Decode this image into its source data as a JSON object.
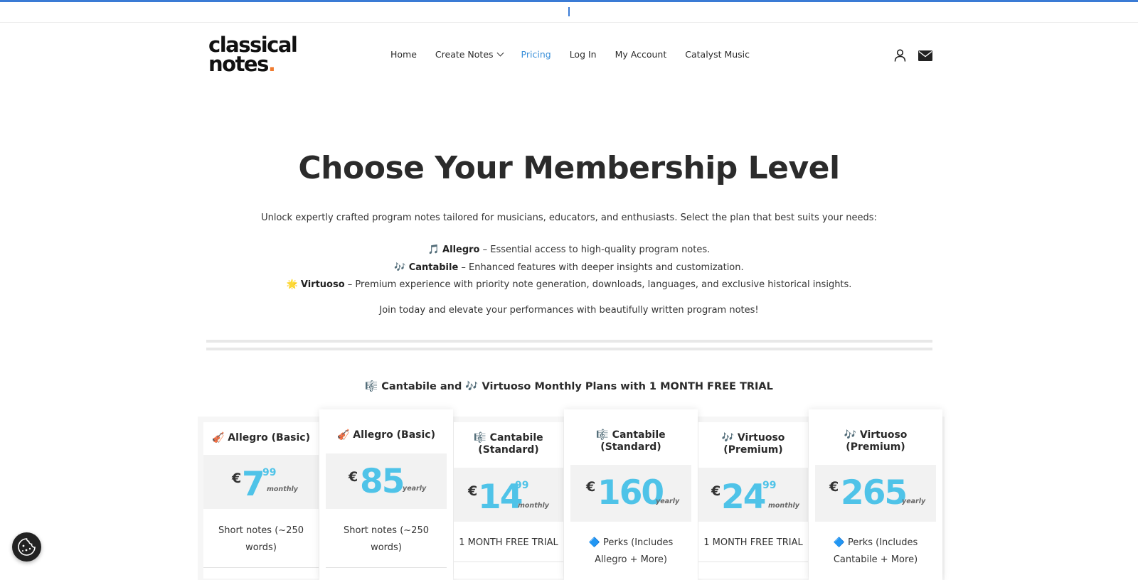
{
  "brand": {
    "logo_line1": "classical",
    "logo_line2": "notes",
    "logo_dot": ".",
    "accent": "#f07b2f"
  },
  "nav": {
    "items": [
      {
        "label": "Home"
      },
      {
        "label": "Create Notes"
      },
      {
        "label": "Pricing"
      },
      {
        "label": "Log In"
      },
      {
        "label": "My Account"
      },
      {
        "label": "Catalyst Music"
      }
    ],
    "active": "Pricing",
    "active_color": "#3a8fd9"
  },
  "header_icons": [
    "user-icon",
    "mail-icon"
  ],
  "hero": {
    "title": "Choose Your Membership Level",
    "intro": "Unlock expertly crafted program notes tailored for musicians, educators, and enthusiasts. Select the plan that best suits your needs:",
    "tiers": [
      {
        "emoji": "🎵",
        "name": "Allegro",
        "desc": " – Essential access to high-quality program notes."
      },
      {
        "emoji": "🎶",
        "name": "Cantabile",
        "desc": " – Enhanced features with deeper insights and customization."
      },
      {
        "emoji": "🌟",
        "name": "Virtuoso",
        "desc": " – Premium experience with priority note generation, downloads, languages, and exclusive historical insights."
      }
    ],
    "join": "Join today and elevate your performances with beautifully written program notes!"
  },
  "plans": {
    "heading": "🎼 Cantabile and 🎶 Virtuoso Monthly Plans with 1 MONTH FREE TRIAL",
    "cards": [
      {
        "title_lines": [
          "🎻 Allegro (Basic)"
        ],
        "currency": "€",
        "amount": "7",
        "cents": "99",
        "period": "monthly",
        "features": [
          "Short notes (~250",
          "words)"
        ]
      },
      {
        "title_lines": [
          "🎻 Allegro (Basic)"
        ],
        "currency": "€",
        "amount": "85",
        "cents": "",
        "period": "yearly",
        "features": [
          "Short notes (~250",
          "words)"
        ]
      },
      {
        "title_lines": [
          "🎼 Cantabile",
          "(Standard)"
        ],
        "currency": "€",
        "amount": "14",
        "cents": "99",
        "period": "monthly",
        "features": [
          "1 MONTH FREE TRIAL"
        ]
      },
      {
        "title_lines": [
          "🎼 Cantabile",
          "(Standard)"
        ],
        "currency": "€",
        "amount": "160",
        "cents": "",
        "period": "yearly",
        "features": [
          "🔷 Perks (Includes",
          "Allegro + More)"
        ]
      },
      {
        "title_lines": [
          "🎶 Virtuoso",
          "(Premium)"
        ],
        "currency": "€",
        "amount": "24",
        "cents": "99",
        "period": "monthly",
        "features": [
          "1 MONTH FREE TRIAL"
        ]
      },
      {
        "title_lines": [
          "🎶 Virtuoso",
          "(Premium)"
        ],
        "currency": "€",
        "amount": "265",
        "cents": "",
        "period": "yearly",
        "features": [
          "🔷 Perks (Includes",
          "Cantabile + More)"
        ]
      }
    ],
    "price_color": "#4fc3e8"
  },
  "cookie_button": {
    "icon": "cookie-icon"
  }
}
